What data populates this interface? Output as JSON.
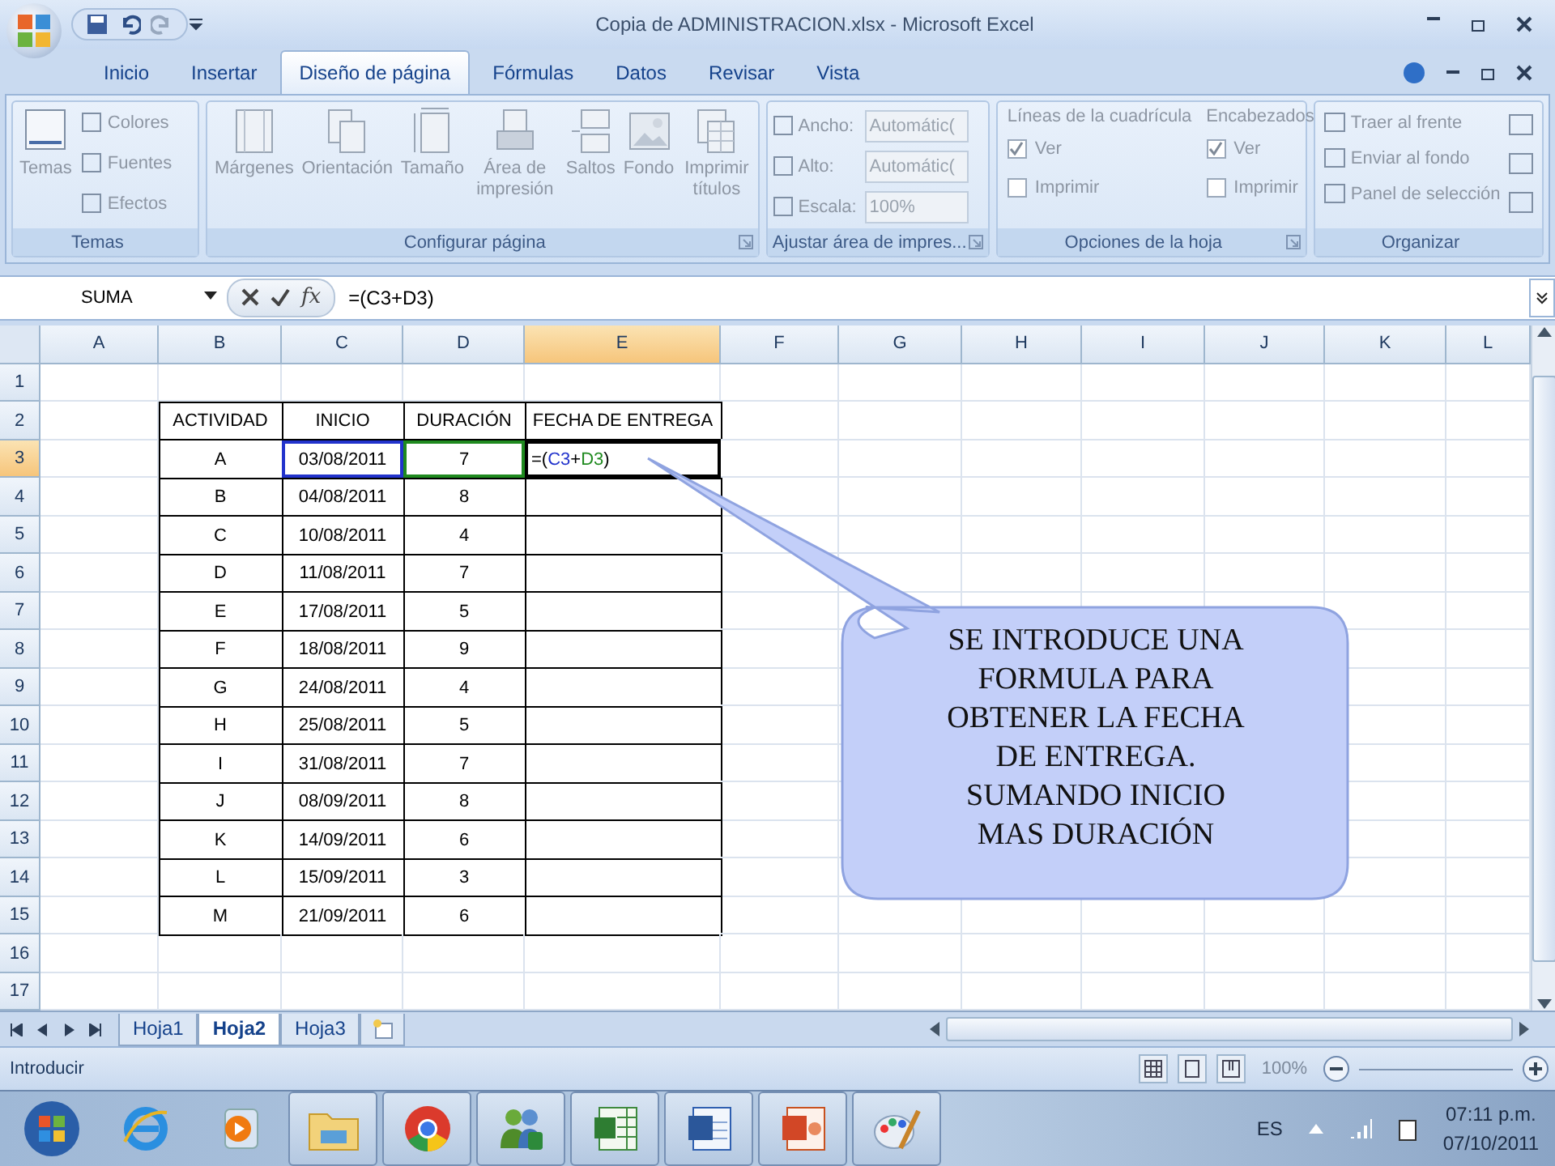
{
  "window": {
    "title": "Copia de ADMINISTRACION.xlsx - Microsoft Excel"
  },
  "tabs": [
    {
      "label": "Inicio",
      "selected": false
    },
    {
      "label": "Insertar",
      "selected": false
    },
    {
      "label": "Diseño de página",
      "selected": true
    },
    {
      "label": "Fórmulas",
      "selected": false
    },
    {
      "label": "Datos",
      "selected": false
    },
    {
      "label": "Revisar",
      "selected": false
    },
    {
      "label": "Vista",
      "selected": false
    }
  ],
  "ribbon": {
    "disabled": true,
    "groups": [
      {
        "kind": "themes",
        "label": "Temas",
        "big": "Temas",
        "items": [
          "Colores",
          "Fuentes",
          "Efectos"
        ]
      },
      {
        "kind": "page_setup",
        "label": "Configurar página",
        "items": [
          "Márgenes",
          "Orientación",
          "Tamaño",
          "Área de impresión",
          "Saltos",
          "Fondo",
          "Imprimir títulos"
        ]
      },
      {
        "kind": "scale",
        "label": "Ajustar área de impres...",
        "fields": [
          {
            "label": "Ancho:",
            "value": "Automátic("
          },
          {
            "label": "Alto:",
            "value": "Automátic("
          },
          {
            "label": "Escala:",
            "value": "100%"
          }
        ]
      },
      {
        "kind": "sheet_options",
        "label": "Opciones de la hoja",
        "columns": [
          {
            "title": "Líneas de la cuadrícula",
            "options": [
              {
                "label": "Ver",
                "checked": true
              },
              {
                "label": "Imprimir",
                "checked": false
              }
            ]
          },
          {
            "title": "Encabezados",
            "options": [
              {
                "label": "Ver",
                "checked": true
              },
              {
                "label": "Imprimir",
                "checked": false
              }
            ]
          }
        ]
      },
      {
        "kind": "arrange",
        "label": "Organizar",
        "items": [
          "Traer al frente",
          "Enviar al fondo",
          "Panel de selección"
        ]
      }
    ]
  },
  "formula_bar": {
    "name_box": "SUMA",
    "function_label": "fx",
    "formula": "=(C3+D3)"
  },
  "sheet": {
    "columns": [
      {
        "label": "A",
        "selected": false
      },
      {
        "label": "B",
        "selected": false
      },
      {
        "label": "C",
        "selected": false
      },
      {
        "label": "D",
        "selected": false
      },
      {
        "label": "E",
        "selected": true
      },
      {
        "label": "F",
        "selected": false
      },
      {
        "label": "G",
        "selected": false
      },
      {
        "label": "H",
        "selected": false
      },
      {
        "label": "I",
        "selected": false
      },
      {
        "label": "J",
        "selected": false
      },
      {
        "label": "K",
        "selected": false
      },
      {
        "label": "L",
        "selected": false
      }
    ],
    "rows": [
      {
        "label": "1",
        "selected": false
      },
      {
        "label": "2",
        "selected": false
      },
      {
        "label": "3",
        "selected": true
      },
      {
        "label": "4",
        "selected": false
      },
      {
        "label": "5",
        "selected": false
      },
      {
        "label": "6",
        "selected": false
      },
      {
        "label": "7",
        "selected": false
      },
      {
        "label": "8",
        "selected": false
      },
      {
        "label": "9",
        "selected": false
      },
      {
        "label": "10",
        "selected": false
      },
      {
        "label": "11",
        "selected": false
      },
      {
        "label": "12",
        "selected": false
      },
      {
        "label": "13",
        "selected": false
      },
      {
        "label": "14",
        "selected": false
      },
      {
        "label": "15",
        "selected": false
      },
      {
        "label": "16",
        "selected": false
      },
      {
        "label": "17",
        "selected": false
      }
    ]
  },
  "table": {
    "columns": [
      "ACTIVIDAD",
      "INICIO",
      "DURACIÓN",
      "FECHA DE ENTREGA"
    ],
    "rows": [
      {
        "cells": [
          "A",
          "03/08/2011",
          "7"
        ],
        "formula": [
          {
            "text": "=("
          },
          {
            "text": "C3",
            "color": "#2233cc"
          },
          {
            "text": "+"
          },
          {
            "text": "D3",
            "color": "#1f8a1f"
          },
          {
            "text": ")"
          }
        ]
      },
      {
        "cells": [
          "B",
          "04/08/2011",
          "8"
        ]
      },
      {
        "cells": [
          "C",
          "10/08/2011",
          "4"
        ]
      },
      {
        "cells": [
          "D",
          "11/08/2011",
          "7"
        ]
      },
      {
        "cells": [
          "E",
          "17/08/2011",
          "5"
        ]
      },
      {
        "cells": [
          "F",
          "18/08/2011",
          "9"
        ]
      },
      {
        "cells": [
          "G",
          "24/08/2011",
          "4"
        ]
      },
      {
        "cells": [
          "H",
          "25/08/2011",
          "5"
        ]
      },
      {
        "cells": [
          "I",
          "31/08/2011",
          "7"
        ]
      },
      {
        "cells": [
          "J",
          "08/09/2011",
          "8"
        ]
      },
      {
        "cells": [
          "K",
          "14/09/2011",
          "6"
        ]
      },
      {
        "cells": [
          "L",
          "15/09/2011",
          "3"
        ]
      },
      {
        "cells": [
          "M",
          "21/09/2011",
          "6"
        ]
      }
    ]
  },
  "callout": {
    "text": "SE INTRODUCE UNA FORMULA PARA OBTENER LA FECHA DE ENTREGA. SUMANDO INICIO MAS DURACIÓN"
  },
  "sheet_tabs": [
    {
      "label": "Hoja1",
      "selected": false
    },
    {
      "label": "Hoja2",
      "selected": true
    },
    {
      "label": "Hoja3",
      "selected": false
    }
  ],
  "status_bar": {
    "mode": "Introducir",
    "zoom": "100%"
  },
  "taskbar": {
    "items": [
      {
        "kind": "browser",
        "running": false
      },
      {
        "kind": "media",
        "running": false
      },
      {
        "kind": "folder",
        "running": true
      },
      {
        "kind": "chrome",
        "running": true
      },
      {
        "kind": "people",
        "running": true
      },
      {
        "kind": "spreadsheet",
        "running": true
      },
      {
        "kind": "document",
        "running": true
      },
      {
        "kind": "presentation",
        "running": true
      },
      {
        "kind": "paint",
        "running": true
      }
    ],
    "language": "ES",
    "time": "07:11 p.m.",
    "date": "07/10/2011"
  }
}
